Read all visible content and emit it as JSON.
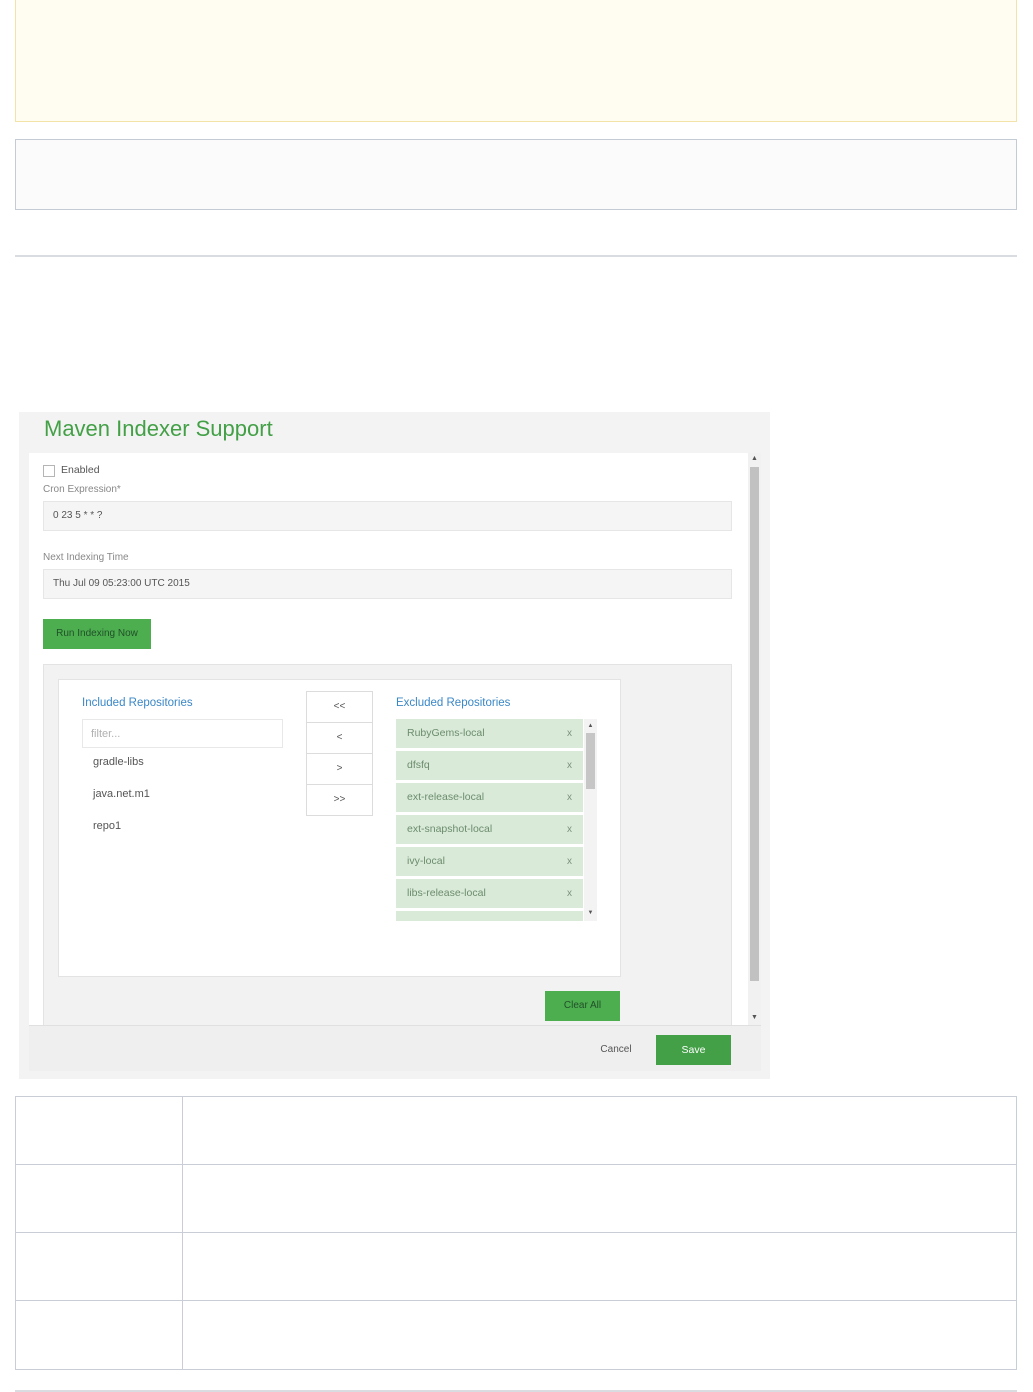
{
  "dialog": {
    "title": "Maven Indexer Support",
    "enabled_label": "Enabled",
    "enabled_checked": false,
    "cron_label": "Cron Expression*",
    "cron_value": "0 23 5 * * ?",
    "next_label": "Next Indexing Time",
    "next_value": "Thu Jul 09 05:23:00 UTC 2015",
    "run_button": "Run Indexing Now",
    "included_title": "Included Repositories",
    "filter_placeholder": "filter...",
    "included": [
      "gradle-libs",
      "java.net.m1",
      "repo1"
    ],
    "move_buttons": [
      "<<",
      "<",
      ">",
      ">>"
    ],
    "excluded_title": "Excluded Repositories",
    "excluded": [
      "RubyGems-local",
      "dfsfq",
      "ext-release-local",
      "ext-snapshot-local",
      "ivy-local",
      "libs-release-local"
    ],
    "remove_glyph": "x",
    "clear_button": "Clear All",
    "cancel_button": "Cancel",
    "save_button": "Save"
  },
  "colors": {
    "accent_green": "#43a047",
    "link_blue": "#3a87c6",
    "excluded_item_bg": "#d9ead9"
  }
}
